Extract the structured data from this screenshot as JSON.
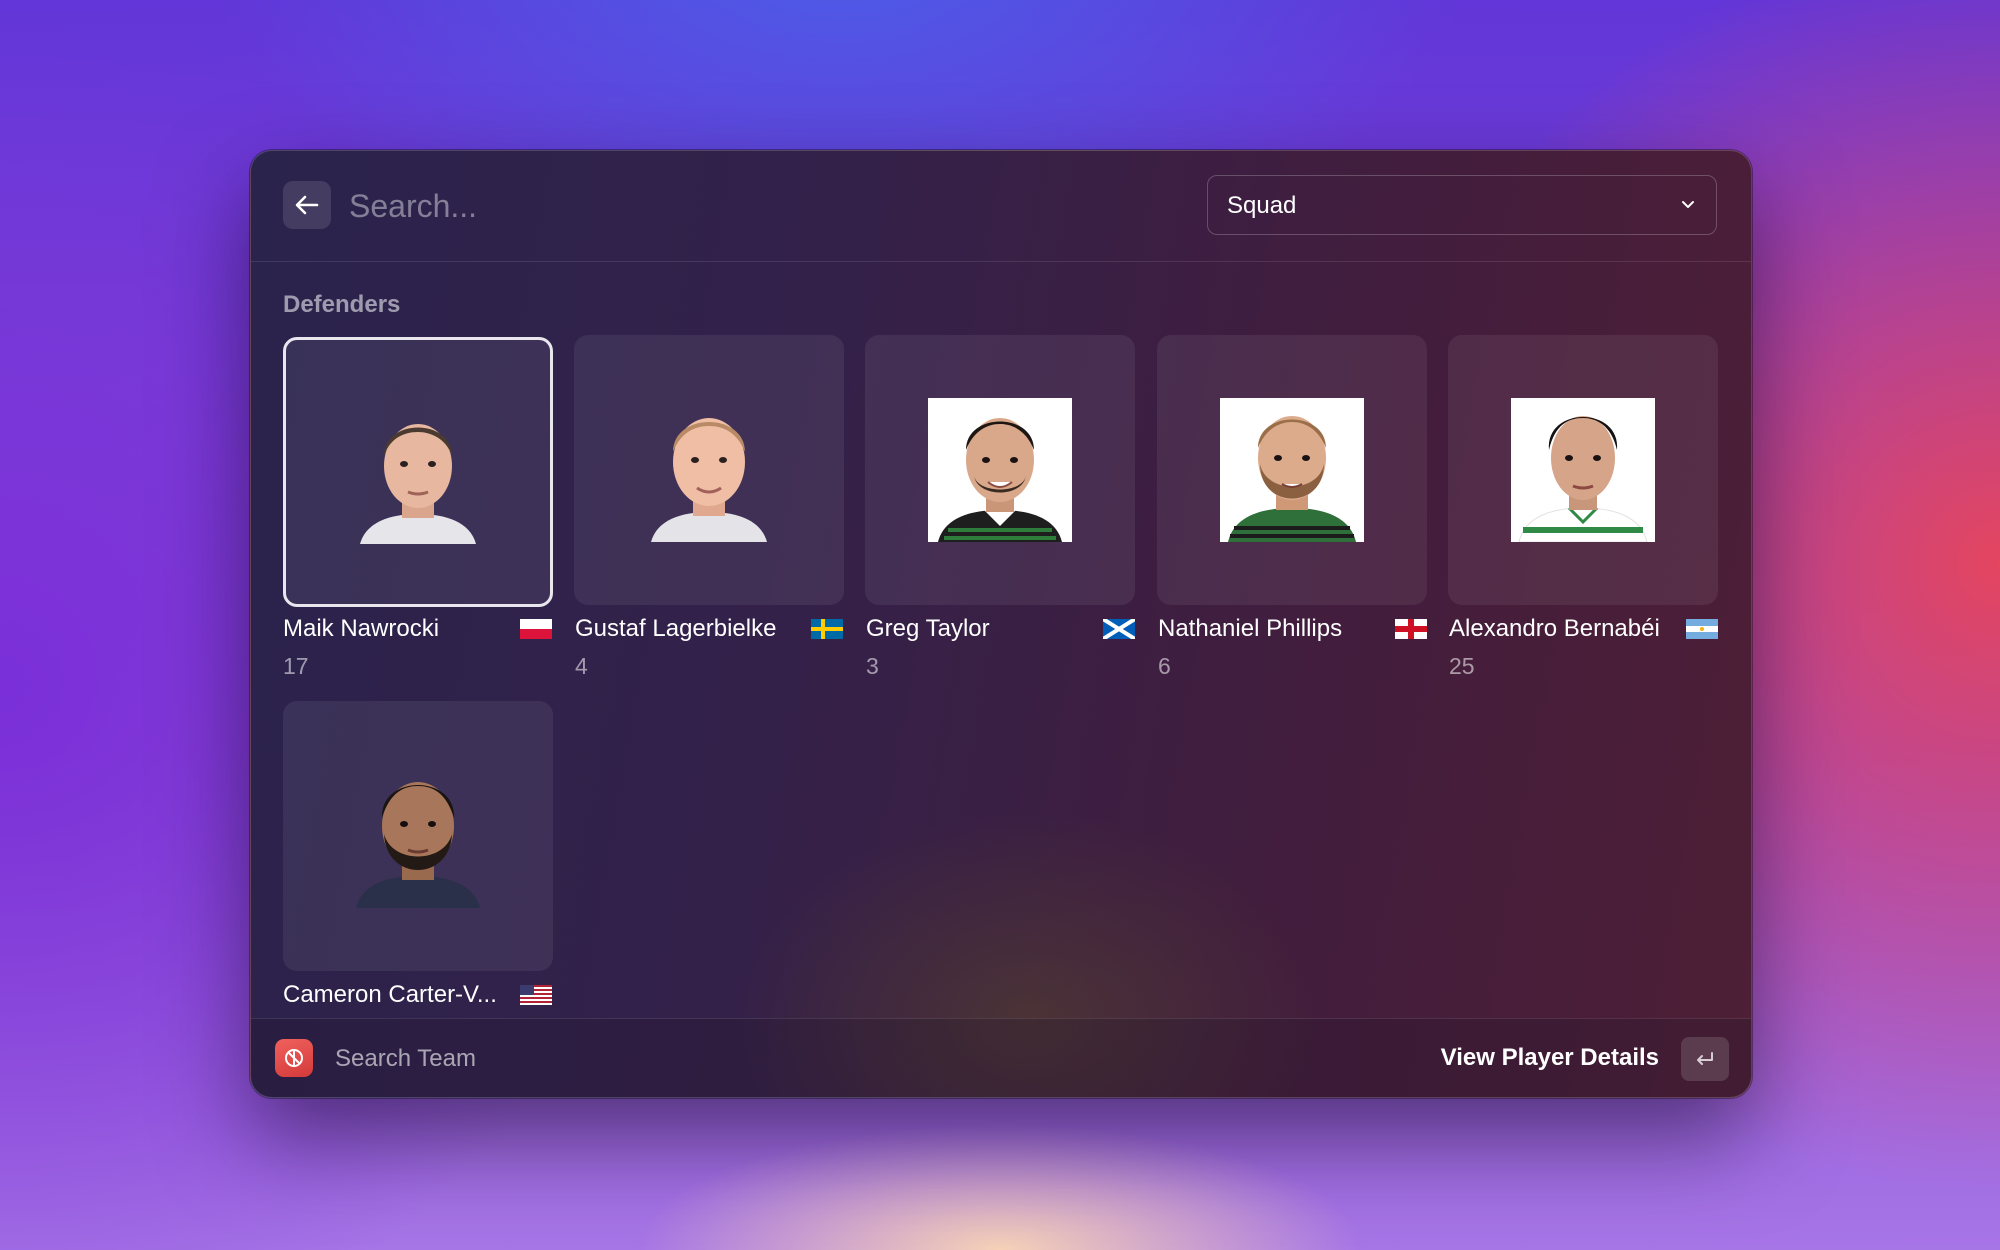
{
  "header": {
    "search_placeholder": "Search...",
    "filter_value": "Squad"
  },
  "section": {
    "title": "Defenders"
  },
  "players": [
    {
      "name": "Maik Nawrocki",
      "number": "17",
      "flag": "poland-flag",
      "selected": true
    },
    {
      "name": "Gustaf Lagerbielke",
      "number": "4",
      "flag": "sweden-flag"
    },
    {
      "name": "Greg Taylor",
      "number": "3",
      "flag": "scotland-flag"
    },
    {
      "name": "Nathaniel Phillips",
      "number": "6",
      "flag": "england-flag"
    },
    {
      "name": "Alexandro Bernabéi",
      "number": "25",
      "flag": "argentina-flag"
    },
    {
      "name": "Cameron Carter-V...",
      "number": "",
      "flag": "usa-flag"
    }
  ],
  "footer": {
    "app_label": "Search Team",
    "action_label": "View Player Details"
  },
  "colors": {
    "selected_border": "#e9e6ee",
    "app_icon": "#e0474a"
  }
}
